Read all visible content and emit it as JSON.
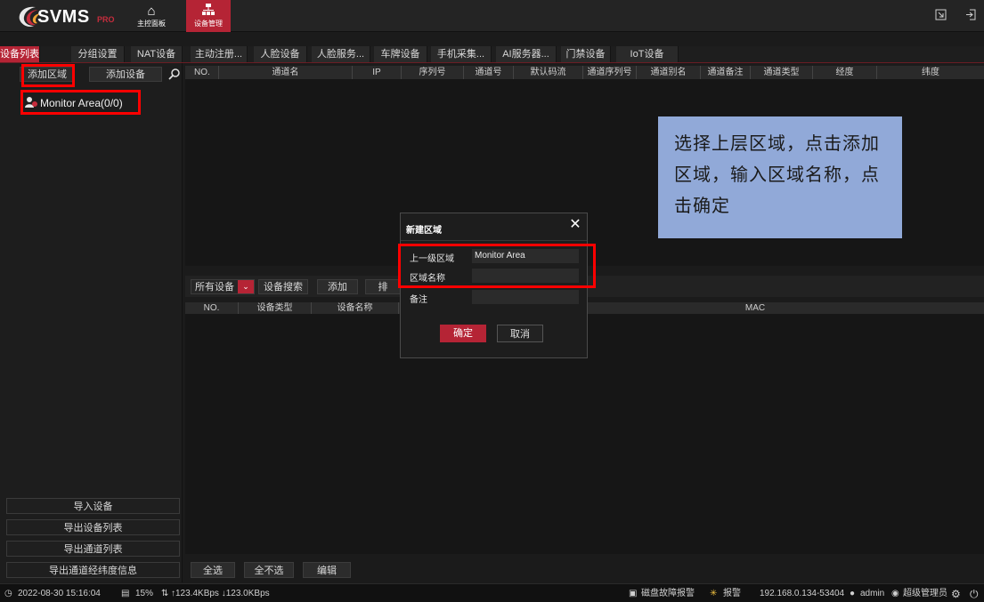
{
  "header": {
    "brand": "SVMS",
    "brand_suffix": "PRO",
    "nav": [
      {
        "label": "主控面板",
        "icon": "home-icon"
      },
      {
        "label": "设备管理",
        "icon": "device-management-icon"
      }
    ],
    "window_buttons": [
      "restore-icon",
      "exit-icon"
    ]
  },
  "tabs": [
    {
      "label": "设备列表",
      "active": true
    },
    {
      "label": "分组设置"
    },
    {
      "label": "NAT设备"
    },
    {
      "label": "主动注册..."
    },
    {
      "label": "人脸设备"
    },
    {
      "label": "人脸服务..."
    },
    {
      "label": "车牌设备"
    },
    {
      "label": "手机采集..."
    },
    {
      "label": "AI服务器..."
    },
    {
      "label": "门禁设备"
    },
    {
      "label": "IoT设备"
    }
  ],
  "left_panel": {
    "add_area_label": "添加区域",
    "add_device_label": "添加设备",
    "tree": [
      {
        "label": "Monitor Area(0/0)"
      }
    ],
    "bottom_buttons": [
      "导入设备",
      "导出设备列表",
      "导出通道列表",
      "导出通道经纬度信息"
    ]
  },
  "channel_table": {
    "columns": [
      "NO.",
      "通道名",
      "IP",
      "序列号",
      "通道号",
      "默认码流",
      "通道序列号",
      "通道别名",
      "通道备注",
      "通道类型",
      "经度",
      "纬度"
    ]
  },
  "device_toolbar": {
    "filter_value": "所有设备",
    "search_label": "设备搜索",
    "add_label": "添加",
    "truncated_label": "排"
  },
  "device_table": {
    "columns": [
      "NO.",
      "设备类型",
      "设备名称",
      "MAC"
    ]
  },
  "bottom_actions": [
    "全选",
    "全不选",
    "编辑"
  ],
  "statusbar": {
    "datetime": "2022-08-30 15:16:04",
    "cpu": "15%",
    "network": "↑123.4KBps ↓123.0KBps",
    "disk_alarm": "磁盘故障报警",
    "alarm": "报警",
    "server": "192.168.0.134-53404",
    "user": "admin",
    "role": "超级管理员"
  },
  "dialog": {
    "title": "新建区域",
    "parent_label": "上一级区域",
    "parent_value": "Monitor Area",
    "name_label": "区域名称",
    "name_value": "",
    "note_label": "备注",
    "note_value": "",
    "ok_label": "确定",
    "cancel_label": "取消"
  },
  "note": {
    "text": "选择上层区域，点击添加区域，输入区域名称，点击确定"
  },
  "colors": {
    "accent": "#b52435",
    "highlight": "#ff0000",
    "note_bg": "#91a9d8"
  }
}
